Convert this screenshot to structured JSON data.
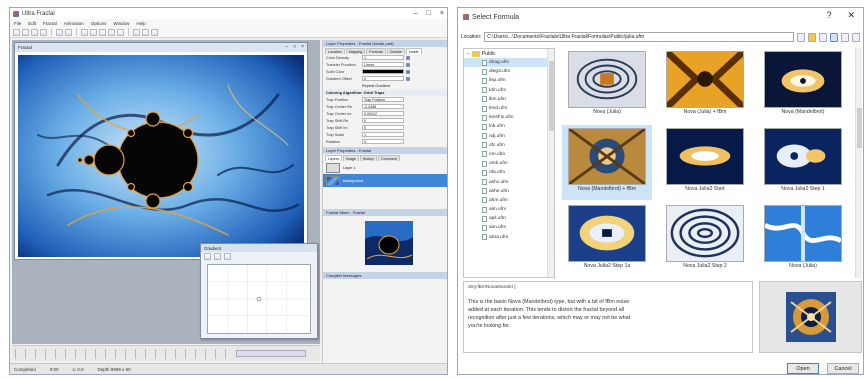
{
  "left_window": {
    "title": "Ultra Fractal",
    "menu": [
      "File",
      "Edit",
      "Fractal",
      "Animation",
      "Options",
      "Window",
      "Help"
    ],
    "fractal_window_title": "Fractal",
    "gradient_window_title": "Gradient",
    "layer_properties_header": "Layer Properties - Fractal (Inside part)",
    "layer_tabs": [
      "Location",
      "Mapping",
      "Formula",
      "Outside",
      "Inside"
    ],
    "properties": [
      {
        "label": "Color Density",
        "value": "1"
      },
      {
        "label": "Transfer Function",
        "value": "Linear"
      },
      {
        "label": "Solid Color",
        "value": ""
      },
      {
        "label": "Gradient Offset",
        "value": "0"
      }
    ],
    "repeat_gradient": "Repeat Gradient",
    "trap_section": "Coloring Algorithm: Orbit Traps",
    "trap_properties": [
      {
        "label": "Trap Position",
        "value": "Trap Position"
      },
      {
        "label": "Trap Center Re",
        "value": "-0.0488"
      },
      {
        "label": "Trap Center Im",
        "value": "0.00012"
      },
      {
        "label": "Trap Shift Re",
        "value": "0"
      },
      {
        "label": "Trap Shift Im",
        "value": "0"
      },
      {
        "label": "Trap Scale",
        "value": "1"
      },
      {
        "label": "Rotation",
        "value": "0"
      }
    ],
    "layers_header": "Layer Properties - Fractal",
    "layers_tabs": [
      "Layers",
      "Image",
      "History",
      "Comment"
    ],
    "layers": [
      {
        "name": "Layer 1",
        "selected": false
      },
      {
        "name": "Background",
        "selected": true
      }
    ],
    "preview_header": "Fractal Mixer - Fractal",
    "messages_header": "Compiler Messages",
    "status": [
      "Completed",
      "0:00",
      "x: 0.0",
      "Depth 9999 x 60"
    ]
  },
  "right_window": {
    "title": "Select Formula",
    "location_label": "Location:",
    "location_path": "C:\\Users\\...\\Documents\\Fractals\\Ultra Fractal\\Formulas\\Public\\julia.ufm",
    "tree_root": "Public",
    "tree_items": [
      "dnag.ufm",
      "dieg3.ufm",
      "lisp.ufm",
      "ldm.ufm",
      "lkm.ufm",
      "lend.ufm",
      "lensFix.ufm",
      "lnb.ufm",
      "ndj.ufm",
      "ofc.ufm",
      "om.ufm",
      "omb.ufm",
      "ofa.ufm",
      "ashc.ufm",
      "ashe.ufm",
      "ahm.ufm",
      "alm.ufm",
      "apil.ufm",
      "aim.ufm",
      "alcia.ufm"
    ],
    "tiles": [
      {
        "caption": "Nova (Julia)",
        "selected": false
      },
      {
        "caption": "Nova (Julia) + fBm",
        "selected": false
      },
      {
        "caption": "Nova (Mandelbrot)",
        "selected": false
      },
      {
        "caption": "Nova (Mandelbrot) + fBm",
        "selected": true
      },
      {
        "caption": "Nova Julia2 Start",
        "selected": false
      },
      {
        "caption": "Nova Julia2 Step 1",
        "selected": false
      },
      {
        "caption": "Nova Julia2 Step 1a",
        "selected": false
      },
      {
        "caption": "Nova Julia2 Step 2",
        "selected": false
      },
      {
        "caption": "Nova (Julia)",
        "selected": false
      }
    ],
    "description_path": "dmj-fBmNovaMandel {",
    "description": "This is the basic Nova (Mandelbrot) type, but with a bit of fBm noise added at each iteration. This tends to distort the fractal beyond all recognition after just a few iterations, which may or may not be what you're looking for.",
    "ok_label": "Open",
    "cancel_label": "Cancel",
    "help_glyph": "?",
    "close_glyph": "✕"
  },
  "colors": {
    "accent": "#3d86d8",
    "selection": "#cde3f8",
    "panel_header": "#c5d3e8"
  }
}
